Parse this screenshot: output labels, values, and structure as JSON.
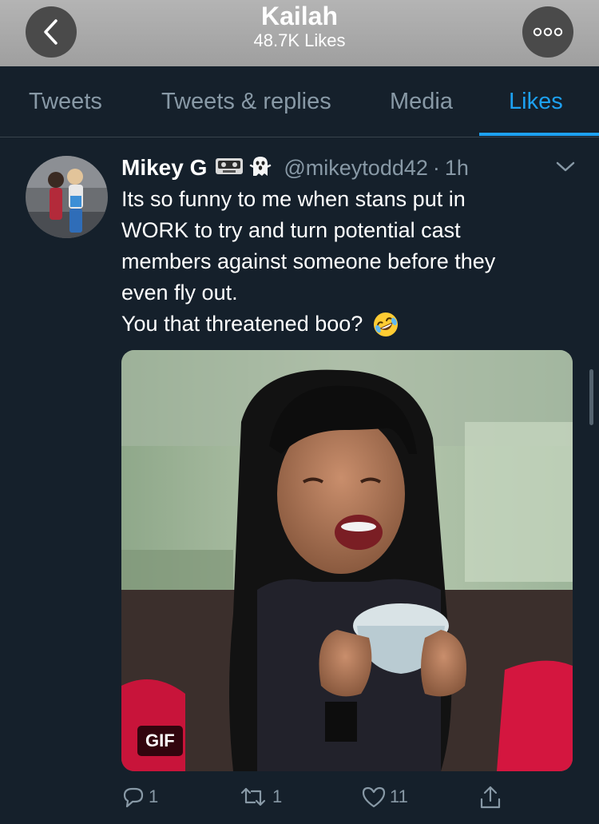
{
  "header": {
    "title": "Kailah",
    "subtitle": "48.7K Likes"
  },
  "tabs": [
    {
      "label": "Tweets",
      "active": false
    },
    {
      "label": "Tweets & replies",
      "active": false
    },
    {
      "label": "Media",
      "active": false
    },
    {
      "label": "Likes",
      "active": true
    }
  ],
  "tweet": {
    "author_name": "Mikey G",
    "name_emojis": [
      "videocassette-icon",
      "ghost-icon"
    ],
    "handle": "@mikeytodd42",
    "separator": "·",
    "time": "1h",
    "lines": [
      "Its so funny to me when stans put in",
      "WORK to try and turn potential cast",
      "members against someone before they",
      "even fly out.",
      "You that threatened boo?"
    ],
    "media_badge": "GIF",
    "replies": "1",
    "retweets": "1",
    "likes": "11"
  },
  "colors": {
    "accent": "#1da1f2",
    "background": "#15202b",
    "secondary_text": "#8899a6"
  }
}
